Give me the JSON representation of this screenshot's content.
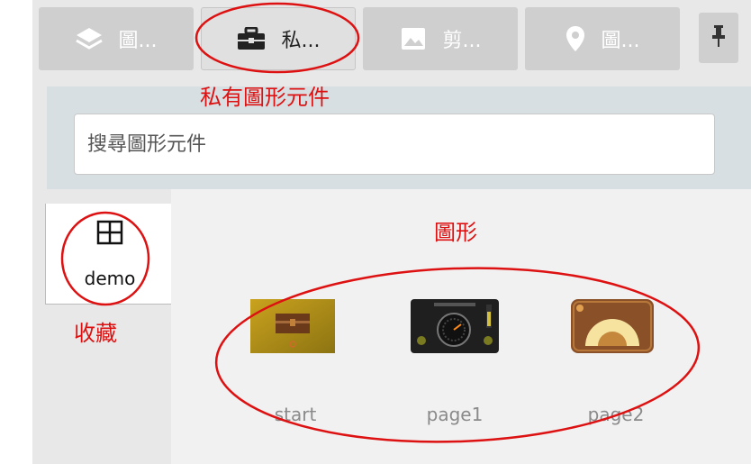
{
  "tabs": [
    {
      "label": "圖...",
      "icon": "layers-icon",
      "active": false
    },
    {
      "label": "私...",
      "icon": "briefcase-icon",
      "active": true
    },
    {
      "label": "剪...",
      "icon": "image-icon",
      "active": false
    },
    {
      "label": "圖...",
      "icon": "map-pin-icon",
      "active": false
    }
  ],
  "pin": {
    "icon": "pushpin-icon"
  },
  "search": {
    "placeholder": "搜尋圖形元件"
  },
  "category": {
    "label": "demo",
    "icon": "grid-icon"
  },
  "items": [
    {
      "label": "start"
    },
    {
      "label": "page1"
    },
    {
      "label": "page2"
    }
  ],
  "annotations": {
    "tab_note": "私有圖形元件",
    "graphics_note": "圖形",
    "favorites_note": "收藏"
  },
  "colors": {
    "annotation": "#dd1111",
    "tab_bg": "#cfcfcf",
    "search_area": "#d7dfe3"
  }
}
